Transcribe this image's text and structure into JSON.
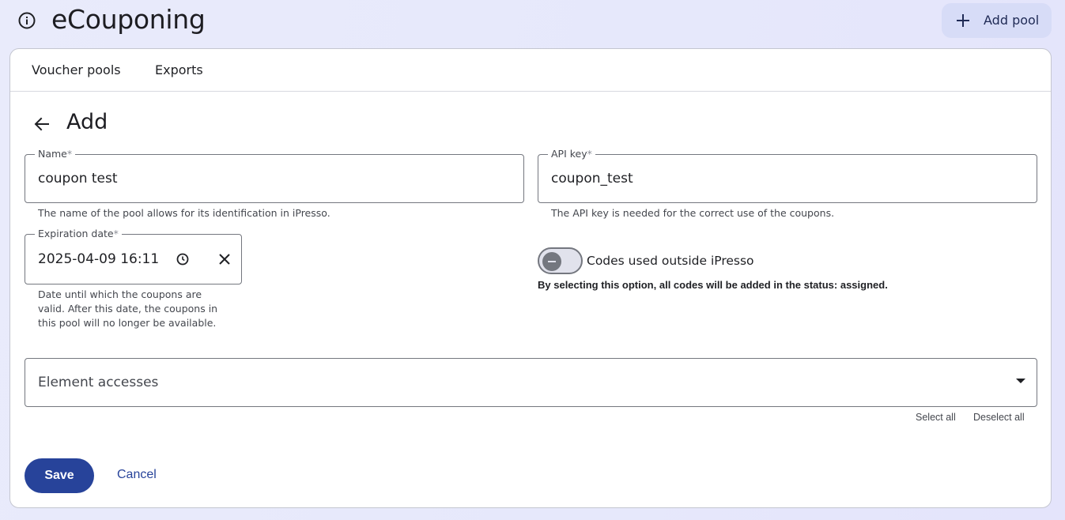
{
  "header": {
    "title": "eCouponing",
    "info_icon": "info-icon",
    "add_pool_label": "Add pool"
  },
  "tabs": [
    {
      "label": "Voucher pools"
    },
    {
      "label": "Exports"
    }
  ],
  "page": {
    "title": "Add"
  },
  "form": {
    "name": {
      "label": "Name",
      "required_mark": "*",
      "value": "coupon test",
      "hint": "The name of the pool allows for its identification in iPresso."
    },
    "api_key": {
      "label": "API key",
      "required_mark": "*",
      "value": "coupon_test",
      "hint": "The API key is needed for the correct use of the coupons."
    },
    "expiration": {
      "label": "Expiration date",
      "required_mark": "*",
      "value": "2025-04-09 16:11",
      "hint": "Date until which the coupons are valid. After this date, the coupons in this pool will no longer be available."
    },
    "codes_outside": {
      "label": "Codes used outside iPresso",
      "description": "By selecting this option, all codes will be added in the status: assigned.",
      "checked": false
    },
    "element_accesses": {
      "placeholder": "Element accesses",
      "select_all": "Select all",
      "deselect_all": "Deselect all"
    }
  },
  "actions": {
    "save": "Save",
    "cancel": "Cancel"
  },
  "colors": {
    "primary": "#27439a",
    "add_pool_bg": "#d7dcf7",
    "page_bg": "#e7e9fb"
  }
}
